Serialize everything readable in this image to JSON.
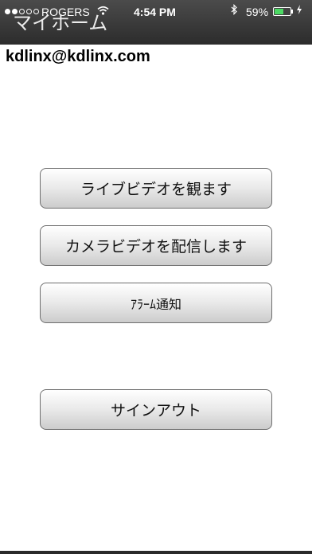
{
  "status_bar": {
    "carrier": "ROGERS",
    "time": "4:54 PM",
    "battery_percent": "59%",
    "battery_level": 0.59,
    "icons": [
      "signal-dots-icon",
      "wifi-icon",
      "bluetooth-icon",
      "battery-icon",
      "charging-icon"
    ]
  },
  "nav": {
    "title": "マイホーム"
  },
  "account": {
    "email": "kdlinx@kdlinx.com"
  },
  "menu": {
    "watch_live": "ライブビデオを観ます",
    "stream_camera": "カメラビデオを配信します",
    "alarm_notifications": "ｱﾗｰﾑ通知",
    "sign_out": "サインアウト"
  },
  "colors": {
    "topbar": "#3a3a3a",
    "battery_fill": "#4cd964",
    "button_border": "#6e6e6e",
    "background": "#ffffff"
  }
}
